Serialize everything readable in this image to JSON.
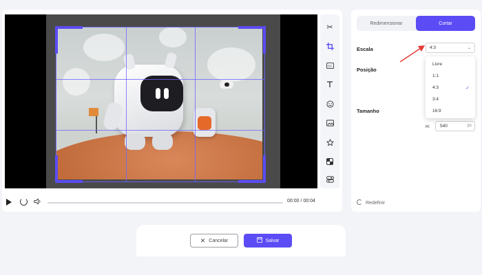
{
  "tabs": {
    "resize_label": "Redimensionar",
    "crop_label": "Cortar"
  },
  "settings": {
    "scale_label": "Escala",
    "scale_value": "4:3",
    "position_label": "Posição",
    "size_label": "Tamanho",
    "height_label": "H:",
    "height_value": "540",
    "height_unit": "px",
    "reset_label": "Redefinir",
    "scale_options": [
      "Livre",
      "1:1",
      "4:3",
      "3:4",
      "16:9"
    ],
    "selected_option": "4:3"
  },
  "player": {
    "time": "00:00 / 00:04",
    "progress": 0
  },
  "tools": [
    "scissors-icon",
    "crop-icon",
    "subtitle-icon",
    "text-icon",
    "emoji-icon",
    "image-icon",
    "star-icon",
    "mosaic-icon",
    "adjust-icon"
  ],
  "footer": {
    "cancel_label": "Cancelar",
    "save_label": "Salvar"
  },
  "colors": {
    "accent": "#5b4cf5",
    "annotation_arrow": "#e53935"
  }
}
